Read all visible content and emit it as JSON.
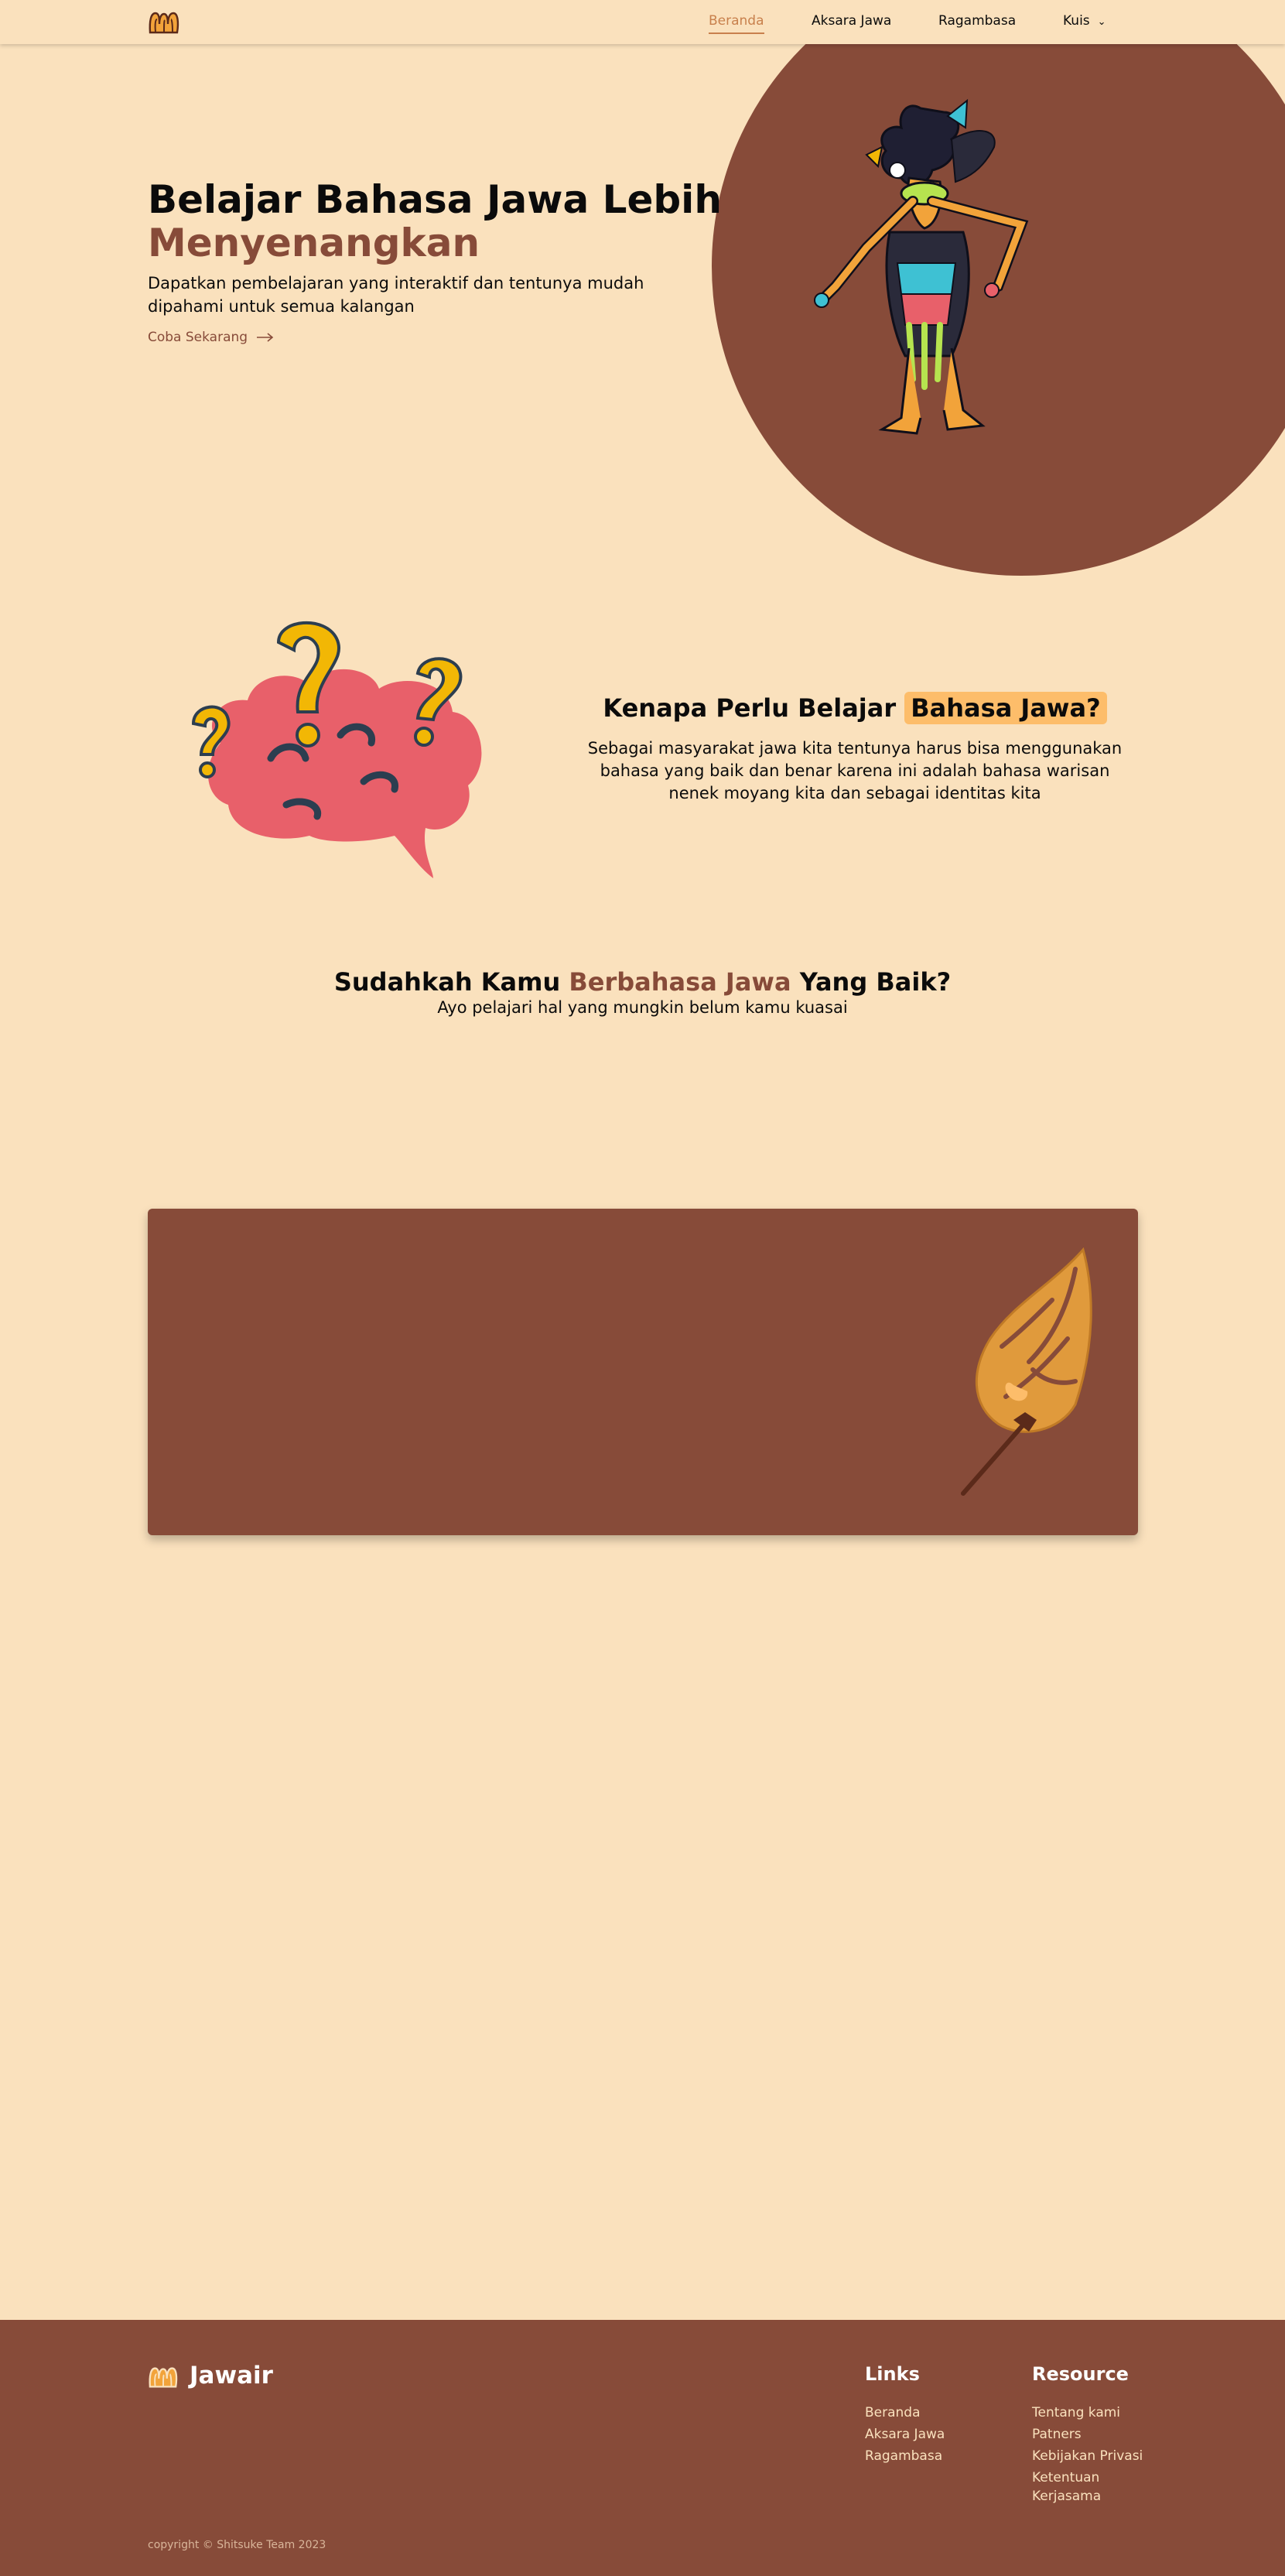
{
  "nav": {
    "items": [
      {
        "label": "Beranda",
        "active": true
      },
      {
        "label": "Aksara Jawa",
        "active": false
      },
      {
        "label": "Ragambasa",
        "active": false
      },
      {
        "label": "Kuis",
        "active": false,
        "has_dropdown": true
      }
    ],
    "logo_icon": "jawair-logo-icon",
    "dropdown_icon": "chevron-down-icon"
  },
  "hero": {
    "title_line1": "Belajar Bahasa Jawa Lebih",
    "title_line2": "Menyenangkan",
    "description": "Dapatkan pembelajaran yang interaktif dan tentunya mudah dipahami untuk semua kalangan",
    "cta_label": "Coba Sekarang",
    "cta_icon": "arrow-right-icon",
    "illustration": "wayang-puppet-illustration"
  },
  "why": {
    "title_plain": "Kenapa Perlu Belajar ",
    "title_highlight": "Bahasa Jawa?",
    "description": "Sebagai masyarakat jawa kita tentunya harus bisa menggunakan bahasa yang baik dan benar karena ini adalah bahasa warisan nenek moyang kita dan sebagai identitas kita",
    "illustration": "brain-question-illustration"
  },
  "quiz": {
    "title_part1": "Sudahkah Kamu ",
    "title_accent": "Berbahasa Jawa",
    "title_part2": " Yang Baik?",
    "subtitle": "Ayo pelajari hal yang mungkin belum kamu kuasai",
    "card_illustration": "gunungan-illustration"
  },
  "footer": {
    "brand": "Jawair",
    "links_title": "Links",
    "links": [
      "Beranda",
      "Aksara Jawa",
      "Ragambasa"
    ],
    "resource_title": "Resource",
    "resources": [
      "Tentang kami",
      "Patners",
      "Kebijakan Privasi",
      "Ketentuan",
      "Kerjasama"
    ],
    "copyright": "copyright © Shitsuke Team 2023"
  },
  "colors": {
    "background": "#fae1bd",
    "brown": "#874b39",
    "highlight": "#fdbd6a",
    "active_nav": "#c8804c",
    "yellow": "#f2b705",
    "pink": "#e8606a"
  }
}
